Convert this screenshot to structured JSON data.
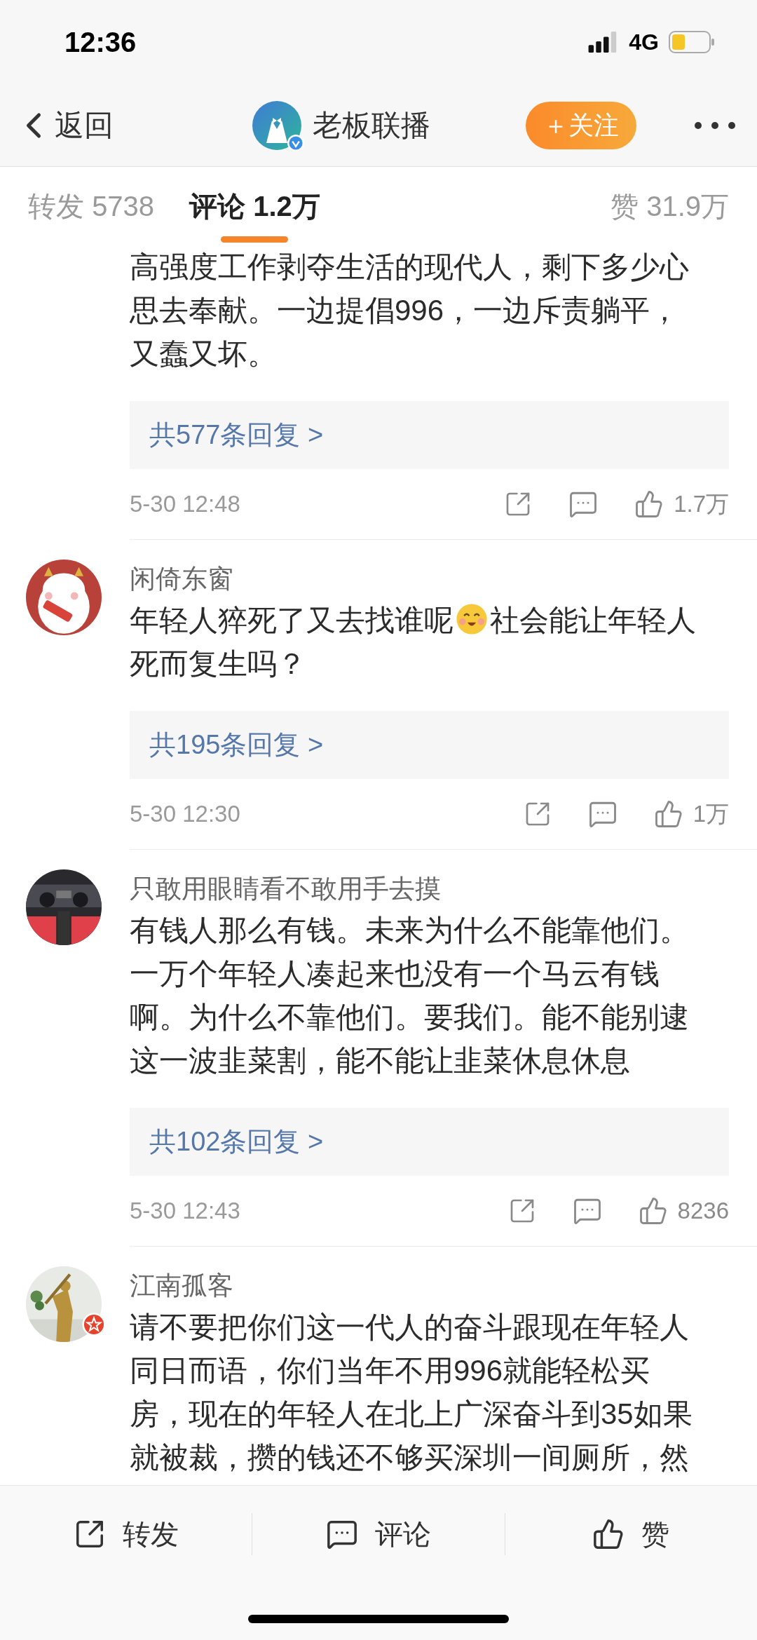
{
  "status_bar": {
    "time": "12:36",
    "network": "4G"
  },
  "nav": {
    "back": "返回",
    "account": "老板联播",
    "verified": true,
    "follow": "＋关注"
  },
  "tabs": [
    {
      "label": "转发",
      "count": "5738",
      "selected": false
    },
    {
      "label": "评论",
      "count": "1.2万",
      "selected": true
    },
    {
      "label": "赞",
      "count": "31.9万",
      "selected": false
    }
  ],
  "comments": [
    {
      "body": [
        {
          "kind": "text",
          "text": "高强度工作剥夺生活的现代人，剩下多少心思去奉献。一边提倡996，一边斥责躺平，又蠢又坏。"
        }
      ],
      "replies": "共577条回复 >",
      "date": "5-30 12:48",
      "likes": "1.7万"
    },
    {
      "user": "闲倚东窗",
      "avatar": {
        "kind": "picture"
      },
      "badge": false,
      "body": [
        {
          "kind": "text",
          "text": "年轻人猝死了又去找谁呢"
        },
        {
          "kind": "emoji"
        },
        {
          "kind": "text",
          "text": "社会能让年轻人死而复生吗？"
        }
      ],
      "replies": "共195条回复 >",
      "date": "5-30 12:30",
      "likes": "1万"
    },
    {
      "user": "只敢用眼睛看不敢用手去摸",
      "avatar": {
        "kind": "picture"
      },
      "badge": false,
      "body": [
        {
          "kind": "text",
          "text": "有钱人那么有钱。未来为什么不能靠他们。一万个年轻人凑起来也没有一个马云有钱啊。为什么不靠他们。要我们。能不能别逮这一波韭菜割，能不能让韭菜休息休息"
        }
      ],
      "replies": "共102条回复 >",
      "date": "5-30 12:43",
      "likes": "8236"
    },
    {
      "user": "江南孤客",
      "avatar": {
        "kind": "picture"
      },
      "badge": true,
      "body": [
        {
          "kind": "text",
          "text": "请不要把你们这一代人的奋斗跟现在年轻人同日而语，你们当年不用996就能轻松买房，现在的年轻人在北上广深奋斗到35如果就被裁，攒的钱还不够买深圳一间厕所，然"
        }
      ]
    }
  ],
  "bottom_bar": [
    {
      "kind": "repost",
      "label": "转发"
    },
    {
      "kind": "comment",
      "label": "评论"
    },
    {
      "kind": "like",
      "label": "赞"
    }
  ]
}
